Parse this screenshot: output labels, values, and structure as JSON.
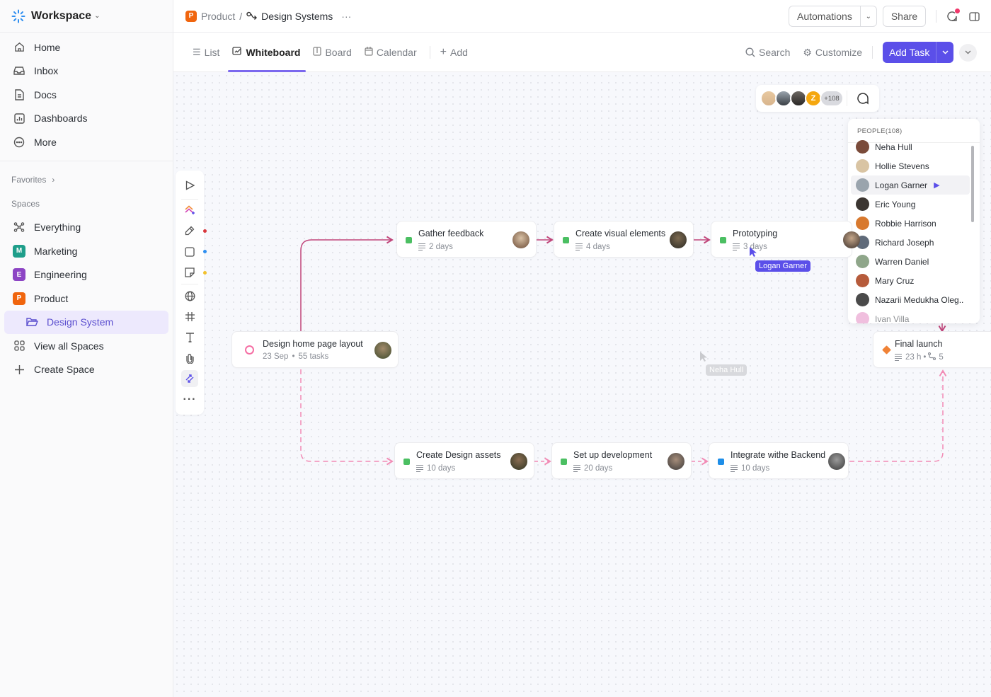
{
  "sidebar": {
    "workspace": "Workspace",
    "nav": [
      {
        "label": "Home",
        "icon": "home-icon"
      },
      {
        "label": "Inbox",
        "icon": "inbox-icon"
      },
      {
        "label": "Docs",
        "icon": "doc-icon"
      },
      {
        "label": "Dashboards",
        "icon": "dashboard-icon"
      },
      {
        "label": "More",
        "icon": "more-icon"
      }
    ],
    "favorites": "Favorites",
    "spaces_title": "Spaces",
    "spaces": [
      {
        "label": "Everything",
        "icon": "everything-icon"
      },
      {
        "label": "Marketing",
        "badge": "M",
        "color": "#1e9e8a"
      },
      {
        "label": "Engineering",
        "badge": "E",
        "color": "#8c44c4"
      },
      {
        "label": "Product",
        "badge": "P",
        "color": "#f0650e"
      }
    ],
    "active_item": "Design System",
    "view_all": "View all Spaces",
    "create": "Create Space"
  },
  "header": {
    "crumb_badge": "P",
    "crumb_space": "Product",
    "crumb_sep": "/",
    "crumb_page": "Design Systems",
    "crumb_more": "···",
    "automations": "Automations",
    "share": "Share"
  },
  "views": {
    "tabs": [
      {
        "label": "List",
        "icon": "list-icon"
      },
      {
        "label": "Whiteboard",
        "icon": "whiteboard-icon",
        "active": true
      },
      {
        "label": "Board",
        "icon": "board-icon"
      },
      {
        "label": "Calendar",
        "icon": "calendar-icon"
      }
    ],
    "add": "Add",
    "search": "Search",
    "customize": "Customize",
    "add_task": "Add Task"
  },
  "collab": {
    "initial": "Z",
    "more": "+108",
    "colors": {
      "z": "#f5a70f",
      "accent": "#5b4fe9"
    }
  },
  "people": {
    "title": "PEOPLE(108)",
    "list": [
      {
        "name": "Neha Hull",
        "color": "#7a4b3a"
      },
      {
        "name": "Hollie Stevens",
        "color": "#d9c4a3"
      },
      {
        "name": "Logan Garner",
        "color": "#9aa4ad",
        "active": true
      },
      {
        "name": "Eric Young",
        "color": "#3b3531"
      },
      {
        "name": "Robbie Harrison",
        "color": "#d8792e"
      },
      {
        "name": "Richard Joseph",
        "color": "#5f6a79"
      },
      {
        "name": "Warren Daniel",
        "color": "#8fa68a"
      },
      {
        "name": "Mary Cruz",
        "color": "#b65b3b"
      },
      {
        "name": "Nazarii Medukha Oleg..",
        "color": "#4a4a4a"
      },
      {
        "name": "Ivan Villa",
        "color": "#e48bc4"
      }
    ]
  },
  "cursors": {
    "logan": "Logan Garner",
    "neha": "Neha Hull"
  },
  "cards": {
    "root": {
      "title": "Design home page layout",
      "date": "23 Sep",
      "sep": "•",
      "tasks": "55 tasks"
    },
    "gather": {
      "title": "Gather feedback",
      "meta": "2 days"
    },
    "visual": {
      "title": "Create visual elements",
      "meta": "4 days"
    },
    "proto": {
      "title": "Prototyping",
      "meta": "3 days"
    },
    "assets": {
      "title": "Create Design assets",
      "meta": "10 days"
    },
    "dev": {
      "title": "Set up development",
      "meta": "20 days"
    },
    "backend": {
      "title": "Integrate withe Backend",
      "meta": "10 days"
    },
    "launch": {
      "title": "Final launch",
      "meta": "23 h",
      "sep": "•",
      "deps": "5"
    }
  },
  "colors": {
    "done_green": "#4bbf62",
    "blue": "#1e8ee8",
    "orange": "#f08236",
    "pink": "#f56fa4",
    "connector": "#c0457a",
    "brand": "#5b4fe9"
  }
}
